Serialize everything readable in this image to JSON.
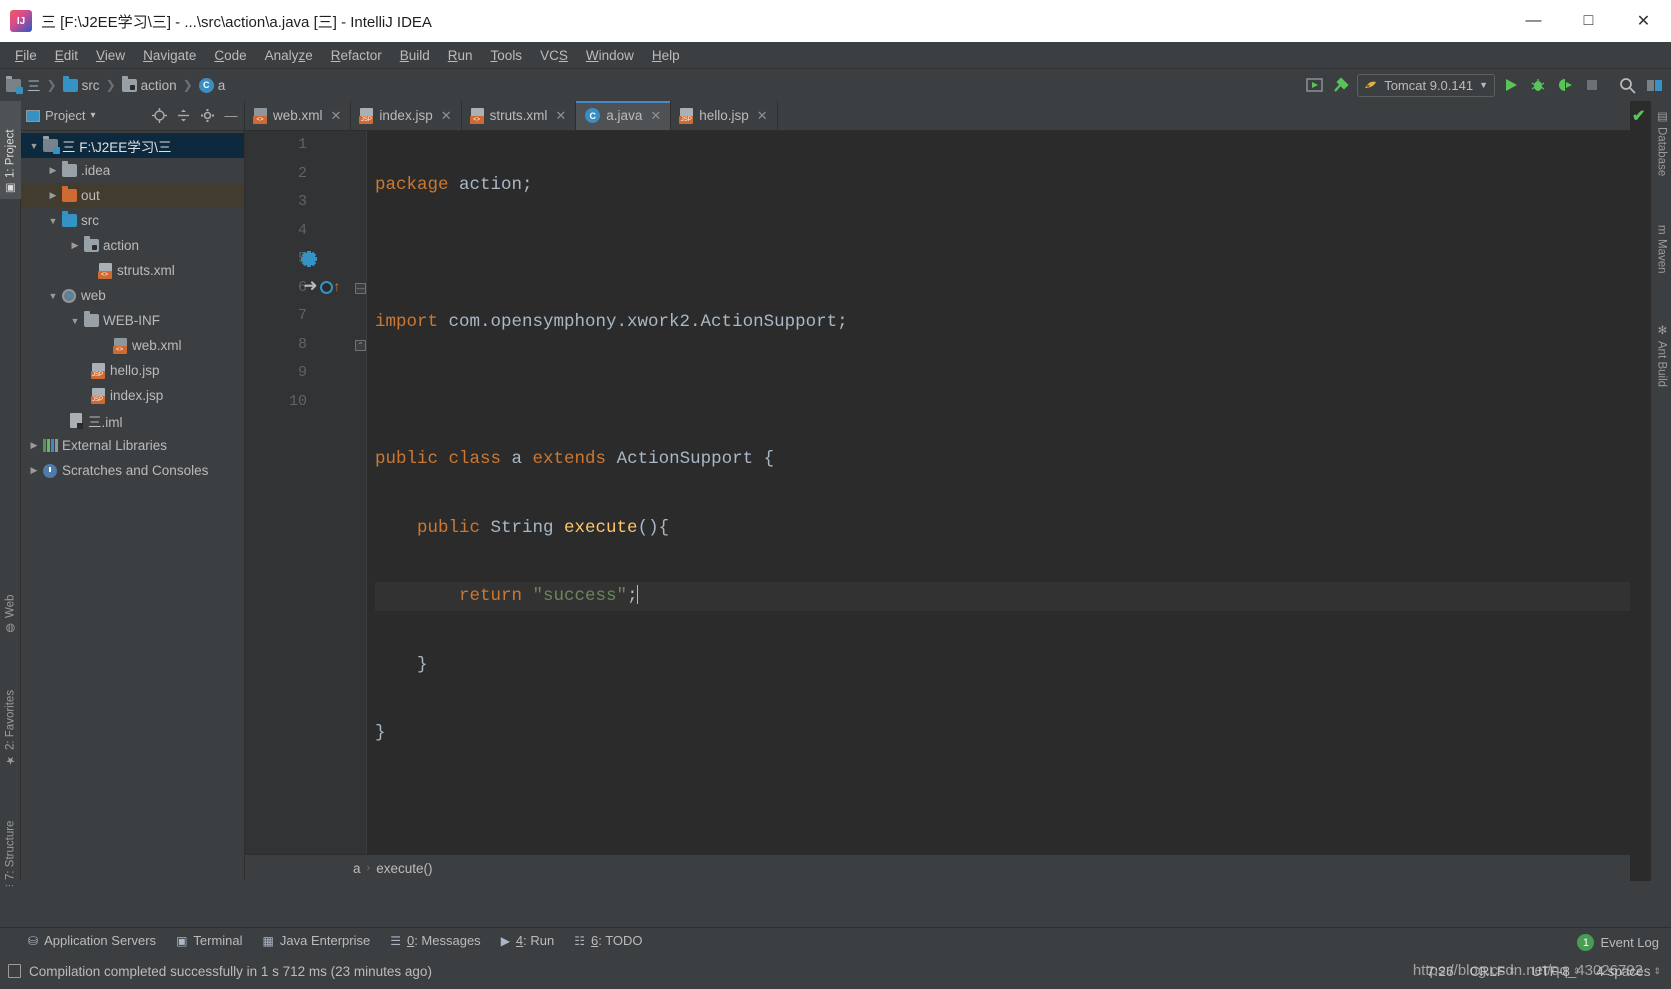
{
  "window": {
    "title": "三 [F:\\J2EE学习\\三] - ...\\src\\action\\a.java [三] - IntelliJ IDEA",
    "minimize": "—",
    "maximize": "□",
    "close": "✕"
  },
  "menubar": [
    {
      "label": "File",
      "mnemonic": "F"
    },
    {
      "label": "Edit",
      "mnemonic": "E"
    },
    {
      "label": "View",
      "mnemonic": "V"
    },
    {
      "label": "Navigate",
      "mnemonic": "N"
    },
    {
      "label": "Code",
      "mnemonic": "C"
    },
    {
      "label": "Analyze",
      "mnemonic": "z"
    },
    {
      "label": "Refactor",
      "mnemonic": "R"
    },
    {
      "label": "Build",
      "mnemonic": "B"
    },
    {
      "label": "Run",
      "mnemonic": "R"
    },
    {
      "label": "Tools",
      "mnemonic": "T"
    },
    {
      "label": "VCS",
      "mnemonic": "S"
    },
    {
      "label": "Window",
      "mnemonic": "W"
    },
    {
      "label": "Help",
      "mnemonic": "H"
    }
  ],
  "navbar": {
    "crumbs": [
      "三",
      "src",
      "action",
      "a"
    ],
    "run_config": "Tomcat 9.0.141",
    "dropdown_glyph": "▼",
    "icons": [
      "updating-app-icon",
      "build-hammer-icon",
      "run-icon",
      "debug-icon",
      "run-with-coverage-icon",
      "stop-icon",
      "search-everywhere-icon",
      "settings-icon"
    ]
  },
  "left_strip": [
    {
      "label": "1: Project",
      "mnemonic": "1",
      "active": true,
      "icon": "project-icon"
    },
    {
      "label": "Web",
      "active": false,
      "icon": "web-icon"
    },
    {
      "label": "2: Favorites",
      "mnemonic": "2",
      "active": false,
      "icon": "star-icon"
    },
    {
      "label": "7: Structure",
      "mnemonic": "7",
      "active": false,
      "icon": "structure-icon"
    }
  ],
  "right_strip": [
    {
      "label": "Database",
      "icon": "database-icon"
    },
    {
      "label": "Maven",
      "icon": "maven-icon"
    },
    {
      "label": "Ant Build",
      "icon": "ant-icon"
    }
  ],
  "project_panel": {
    "title": "Project",
    "dropdown_glyph": "▾",
    "actions": [
      "locate-icon",
      "collapse-all-icon",
      "gear-icon",
      "hide-icon"
    ],
    "tree": [
      {
        "label": "F:\\J2EE学习\\三",
        "prefix": "三",
        "depth": 0,
        "arrow": "▼",
        "icon": "project-root-folder",
        "state": "selected"
      },
      {
        "label": ".idea",
        "depth": 1,
        "arrow": "▶",
        "icon": "folder-gray",
        "state": "none"
      },
      {
        "label": "out",
        "depth": 1,
        "arrow": "▶",
        "icon": "folder-orange",
        "state": "amber"
      },
      {
        "label": "src",
        "depth": 1,
        "arrow": "▼",
        "icon": "folder-blue-source",
        "state": "none"
      },
      {
        "label": "action",
        "depth": 2,
        "arrow": "▶",
        "icon": "folder-package",
        "state": "none"
      },
      {
        "label": "struts.xml",
        "depth": 3,
        "arrow": "",
        "icon": "xml-file-icon",
        "state": "none"
      },
      {
        "label": "web",
        "depth": 1,
        "arrow": "▼",
        "icon": "web-module-icon",
        "state": "none"
      },
      {
        "label": "WEB-INF",
        "depth": 2,
        "arrow": "▼",
        "icon": "folder-gray",
        "state": "none"
      },
      {
        "label": "web.xml",
        "depth": 3,
        "arrow": "",
        "icon": "web-xml-file-icon",
        "state": "none"
      },
      {
        "label": "hello.jsp",
        "depth": 2,
        "arrow": "",
        "icon": "jsp-file-icon",
        "state": "none"
      },
      {
        "label": "index.jsp",
        "depth": 2,
        "arrow": "",
        "icon": "jsp-file-icon",
        "state": "none"
      },
      {
        "label": "三.iml",
        "depth": 1,
        "arrow": "",
        "icon": "iml-file-icon",
        "state": "none"
      },
      {
        "label": "External Libraries",
        "depth": 0,
        "arrow": "▶",
        "icon": "libraries-icon",
        "state": "none"
      },
      {
        "label": "Scratches and Consoles",
        "depth": 0,
        "arrow": "▶",
        "icon": "scratches-icon",
        "state": "none"
      }
    ]
  },
  "editor": {
    "tabs": [
      {
        "label": "web.xml",
        "icon": "web-xml-file-icon",
        "active": false,
        "close": "✕"
      },
      {
        "label": "index.jsp",
        "icon": "jsp-file-icon",
        "active": false,
        "close": "✕"
      },
      {
        "label": "struts.xml",
        "icon": "xml-file-icon",
        "active": false,
        "close": "✕"
      },
      {
        "label": "a.java",
        "icon": "java-class-icon",
        "active": true,
        "close": "✕"
      },
      {
        "label": "hello.jsp",
        "icon": "jsp-file-icon",
        "active": false,
        "close": "✕"
      }
    ],
    "line_numbers": [
      "1",
      "2",
      "3",
      "4",
      "5",
      "6",
      "7",
      "8",
      "9",
      "10"
    ],
    "code_lines": [
      {
        "n": 1,
        "tokens": [
          {
            "t": "package",
            "c": "kw"
          },
          {
            "t": " action;",
            "c": "plain"
          }
        ]
      },
      {
        "n": 2,
        "tokens": []
      },
      {
        "n": 3,
        "tokens": [
          {
            "t": "import",
            "c": "kw"
          },
          {
            "t": " com.opensymphony.xwork2.ActionSupport;",
            "c": "plain"
          }
        ]
      },
      {
        "n": 4,
        "tokens": []
      },
      {
        "n": 5,
        "tokens": [
          {
            "t": "public class",
            "c": "kw"
          },
          {
            "t": " a ",
            "c": "plain"
          },
          {
            "t": "extends",
            "c": "kw"
          },
          {
            "t": " ActionSupport {",
            "c": "plain"
          }
        ]
      },
      {
        "n": 6,
        "tokens": [
          {
            "t": "    ",
            "c": "plain"
          },
          {
            "t": "public",
            "c": "kw"
          },
          {
            "t": " String ",
            "c": "plain"
          },
          {
            "t": "execute",
            "c": "mth"
          },
          {
            "t": "(){",
            "c": "plain"
          }
        ]
      },
      {
        "n": 7,
        "tokens": [
          {
            "t": "        ",
            "c": "plain"
          },
          {
            "t": "return",
            "c": "kw"
          },
          {
            "t": " ",
            "c": "plain"
          },
          {
            "t": "\"success\"",
            "c": "str"
          },
          {
            "t": ";",
            "c": "plain"
          }
        ],
        "caret": true
      },
      {
        "n": 8,
        "tokens": [
          {
            "t": "    }",
            "c": "plain"
          }
        ]
      },
      {
        "n": 9,
        "tokens": [
          {
            "t": "}",
            "c": "plain"
          }
        ]
      },
      {
        "n": 10,
        "tokens": []
      }
    ],
    "gutter_marks": {
      "line5": "recompile-gear-icon",
      "line6": "overriding-method-icon"
    },
    "inspection_status": "✔",
    "breadcrumb": [
      "a",
      "execute()"
    ],
    "breadcrumb_sep": "›"
  },
  "toolwindow_bar": [
    {
      "label": "Application Servers",
      "icon": "app-server-icon"
    },
    {
      "label": "Terminal",
      "icon": "terminal-icon"
    },
    {
      "label": "Java Enterprise",
      "icon": "java-ee-icon"
    },
    {
      "label": "0: Messages",
      "mnemonic": "0",
      "icon": "messages-icon"
    },
    {
      "label": "4: Run",
      "mnemonic": "4",
      "icon": "run-icon"
    },
    {
      "label": "6: TODO",
      "mnemonic": "6",
      "icon": "todo-icon"
    }
  ],
  "statusbar": {
    "message": "Compilation completed successfully in 1 s 712 ms (23 minutes ago)",
    "caret_position": "7:26",
    "line_separator": "CRLF",
    "encoding": "UTF-8",
    "indent": "4 spaces",
    "event_log": "Event Log",
    "event_count": "1",
    "watermark": "https://blog.csdn.net/qq_43026792"
  }
}
